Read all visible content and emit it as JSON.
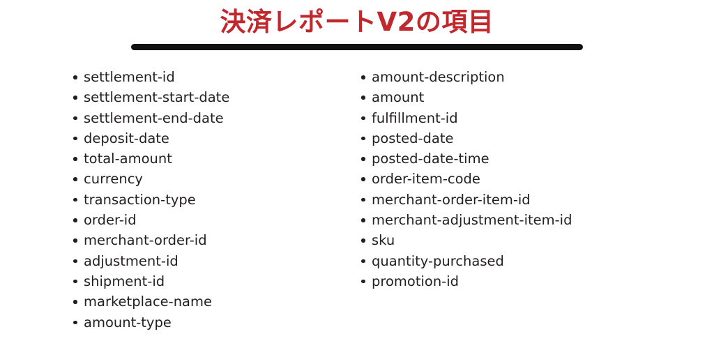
{
  "slide": {
    "title": "決済レポートV2の項目",
    "title_color": "#C0282D",
    "rule_color": "#111111",
    "text_color": "#231F20",
    "background_color": "#FFFFFF",
    "bullet_glyph": "•"
  },
  "columns": {
    "left": {
      "items": [
        {
          "label": "settlement-id"
        },
        {
          "label": "settlement-start-date"
        },
        {
          "label": "settlement-end-date"
        },
        {
          "label": "deposit-date"
        },
        {
          "label": "total-amount"
        },
        {
          "label": "currency"
        },
        {
          "label": "transaction-type"
        },
        {
          "label": "order-id"
        },
        {
          "label": "merchant-order-id"
        },
        {
          "label": "adjustment-id"
        },
        {
          "label": "shipment-id"
        },
        {
          "label": "marketplace-name"
        },
        {
          "label": "amount-type"
        }
      ]
    },
    "right": {
      "items": [
        {
          "label": "amount-description"
        },
        {
          "label": "amount"
        },
        {
          "label": "fulfillment-id"
        },
        {
          "label": "posted-date"
        },
        {
          "label": "posted-date-time"
        },
        {
          "label": "order-item-code"
        },
        {
          "label": "merchant-order-item-id"
        },
        {
          "label": "merchant-adjustment-item-id"
        },
        {
          "label": "sku"
        },
        {
          "label": "quantity-purchased"
        },
        {
          "label": "promotion-id"
        }
      ]
    }
  }
}
